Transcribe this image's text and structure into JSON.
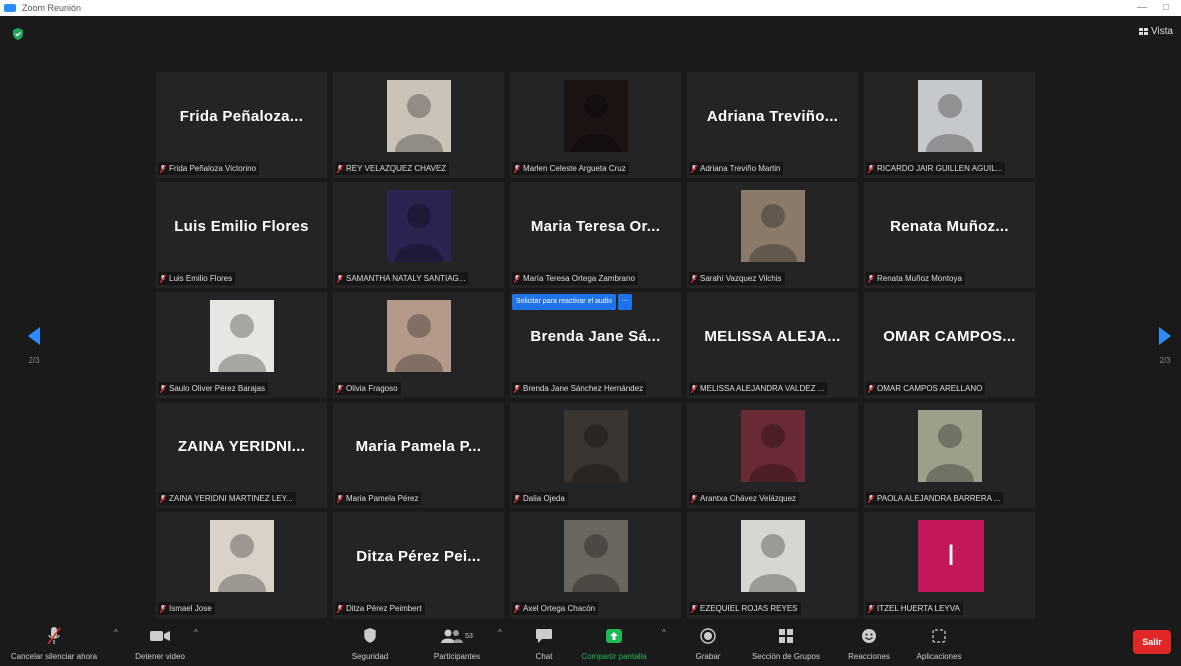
{
  "window": {
    "title": "Zoom Reunión"
  },
  "view_button": {
    "label": "Vista"
  },
  "pagination": {
    "left_page": "2/3",
    "right_page": "2/3"
  },
  "audio_request": {
    "button_label": "Solicitar para reactivar el audio",
    "more": "···"
  },
  "participants": [
    {
      "display": "Frida Peñaloza...",
      "label": "Frida Peñaloza Victorino",
      "video": false
    },
    {
      "display": "",
      "label": "REY VELAZQUEZ CHAVEZ",
      "video": true,
      "bg": "#c9c3b8"
    },
    {
      "display": "",
      "label": "Marlen Celeste Argueta Cruz",
      "video": true,
      "bg": "#1b1412"
    },
    {
      "display": "Adriana Treviño...",
      "label": "Adriana Treviño Martin",
      "video": false
    },
    {
      "display": "",
      "label": "RICARDO JAIR GUILLEN AGUIL...",
      "video": true,
      "bg": "#c6c9cc"
    },
    {
      "display": "Luis Emilio Flores",
      "label": "Luis Emilio Flores",
      "video": false
    },
    {
      "display": "",
      "label": "SAMANTHA NATALY SANTIAG...",
      "video": true,
      "bg": "#2a2550"
    },
    {
      "display": "Maria Teresa Or...",
      "label": "María Teresa Ortega Zambrano",
      "video": false
    },
    {
      "display": "",
      "label": "Sarahí Vazquez Vilchis",
      "video": true,
      "bg": "#8a7a6a"
    },
    {
      "display": "Renata Muñoz...",
      "label": "Renata Muñoz Montoya",
      "video": false
    },
    {
      "display": "",
      "label": "Saulo Oliver Pérez Barajas",
      "video": true,
      "bg": "#e8e6e2"
    },
    {
      "display": "",
      "label": "Olivia Fragoso",
      "video": true,
      "bg": "#b49a8a"
    },
    {
      "display": "Brenda Jane Sá...",
      "label": "Brenda Jane Sánchez Hernández",
      "video": false,
      "request": true
    },
    {
      "display": "MELISSA ALEJA...",
      "label": "MELISSA ALEJANDRA VALDEZ ...",
      "video": false
    },
    {
      "display": "OMAR CAMPOS...",
      "label": "OMAR CAMPOS ARELLANO",
      "video": false
    },
    {
      "display": "ZAINA YERIDNI...",
      "label": "ZAINA YERIDNI MARTINEZ LEY...",
      "video": false
    },
    {
      "display": "Maria Pamela P...",
      "label": "Maria Pamela Pérez",
      "video": false
    },
    {
      "display": "",
      "label": "Dalia Ojeda",
      "video": true,
      "bg": "#3a3530"
    },
    {
      "display": "",
      "label": "Arantxa Chávez Velázquez",
      "video": true,
      "bg": "#6a2a35"
    },
    {
      "display": "",
      "label": "PAOLA ALEJANDRA BARRERA ...",
      "video": true,
      "bg": "#9aa08a"
    },
    {
      "display": "",
      "label": "Ismael Jose",
      "video": true,
      "bg": "#d8d2c8"
    },
    {
      "display": "Ditza Pérez Pei...",
      "label": "Ditza Pérez Peimbert",
      "video": false
    },
    {
      "display": "",
      "label": "Axel Ortega Chacón",
      "video": true,
      "bg": "#6a6660"
    },
    {
      "display": "",
      "label": "EZEQUIEL ROJAS REYES",
      "video": true,
      "bg": "#d8d6d2"
    },
    {
      "display": "",
      "label": "ITZEL HUERTA LEYVA",
      "video": true,
      "bg": "#c2185b",
      "initial": "I"
    }
  ],
  "toolbar": {
    "mute": "Cancelar silenciar ahora",
    "video": "Detener video",
    "security": "Seguridad",
    "participants": "Participantes",
    "participants_count": "53",
    "chat": "Chat",
    "share": "Compartir pantalla",
    "record": "Grabar",
    "breakout": "Sección de Grupos",
    "reactions": "Reacciones",
    "apps": "Aplicaciones",
    "leave": "Salir"
  },
  "colors": {
    "share_green": "#1db954",
    "leave_red": "#e02828",
    "accent_blue": "#2d8cff"
  }
}
